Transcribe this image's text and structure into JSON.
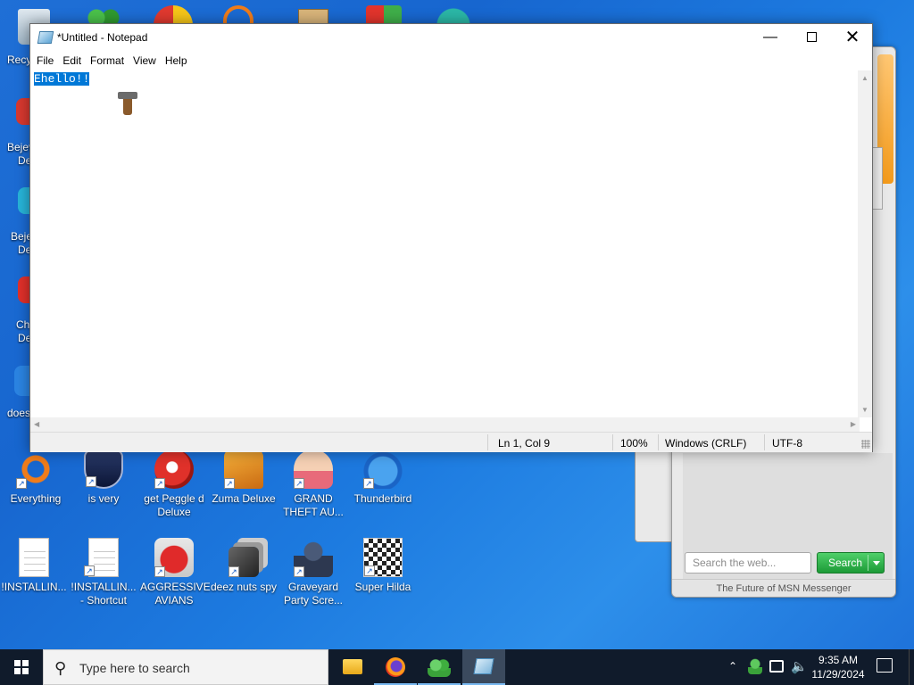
{
  "desktop": {
    "partial_left": [
      {
        "label": "Recy"
      },
      {
        "label": "Bejev"
      },
      {
        "label": "De"
      },
      {
        "label": "Beje"
      },
      {
        "label": "De"
      },
      {
        "label": "Ch"
      },
      {
        "label": "De"
      },
      {
        "label": "does"
      }
    ],
    "row1": [
      {
        "label": "Everything",
        "icon": "everything-icon"
      },
      {
        "label": "is very",
        "icon": "shield-logo-icon"
      },
      {
        "label": "get Peggle d Deluxe",
        "icon": "peggle-icon"
      },
      {
        "label": "Zuma Deluxe",
        "icon": "zuma-icon"
      },
      {
        "label": "GRAND THEFT AU...",
        "icon": "anime-girl-icon"
      },
      {
        "label": "Thunderbird",
        "icon": "thunderbird-icon"
      }
    ],
    "row2": [
      {
        "label": "!INSTALLIN...",
        "icon": "document-icon"
      },
      {
        "label": "!INSTALLIN... - Shortcut",
        "icon": "document-icon"
      },
      {
        "label": "AGGRESSIVE AVIANS",
        "icon": "angry-bird-icon"
      },
      {
        "label": "deez nuts spy",
        "icon": "stacked-windows-icon"
      },
      {
        "label": "Graveyard Party Scre...",
        "icon": "knight-icon"
      },
      {
        "label": "Super Hilda",
        "icon": "pixel-art-icon"
      }
    ]
  },
  "msn": {
    "search_placeholder": "Search the web...",
    "search_button": "Search",
    "footer": "The Future of MSN Messenger"
  },
  "notepad": {
    "title": "*Untitled - Notepad",
    "menu": [
      "File",
      "Edit",
      "Format",
      "View",
      "Help"
    ],
    "content_selected": "Ehello!!",
    "status": {
      "position": "Ln 1, Col 9",
      "zoom": "100%",
      "line_endings": "Windows (CRLF)",
      "encoding": "UTF-8"
    }
  },
  "taskbar": {
    "search_placeholder": "Type here to search",
    "apps": [
      {
        "name": "file-explorer-icon"
      },
      {
        "name": "firefox-icon"
      },
      {
        "name": "messenger-icon"
      },
      {
        "name": "notepad-icon"
      }
    ],
    "time": "9:35 AM",
    "date": "11/29/2024"
  },
  "colors": {
    "selection": "#0078d7",
    "taskbar": "#101b2b",
    "search_green": "#1c9a36"
  }
}
